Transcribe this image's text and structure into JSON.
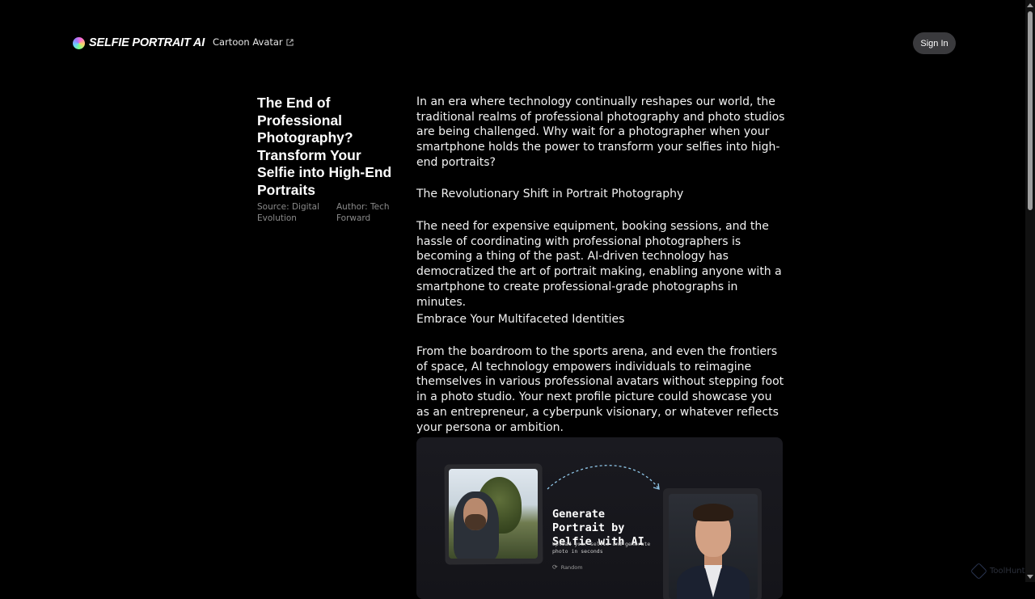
{
  "header": {
    "logo_text": "SELFIE PORTRAIT AI",
    "nav_link": "Cartoon Avatar",
    "sign_in": "Sign In"
  },
  "article": {
    "title": "The End of Professional Photography? Transform Your Selfie into High-End Portraits",
    "source": "Source: Digital Evolution",
    "author": "Author: Tech Forward",
    "paragraphs": [
      "In an era where technology continually reshapes our world, the traditional realms of professional photography and photo studios are being challenged. Why wait for a photographer when your smartphone holds the power to transform your selfies into high-end portraits?",
      "The Revolutionary Shift in Portrait Photography",
      "The need for expensive equipment, booking sessions, and the hassle of coordinating with professional photographers is becoming a thing of the past. AI-driven technology has democratized the art of portrait making, enabling anyone with a smartphone to create professional-grade photographs in minutes.",
      "Embrace Your Multifaceted Identities",
      "From the boardroom to the sports arena, and even the frontiers of space, AI technology empowers individuals to reimagine themselves in various professional avatars without stepping foot in a photo studio. Your next profile picture could showcase you as an entrepreneur, a cyberpunk visionary, or whatever reflects your persona or ambition."
    ]
  },
  "promo_card": {
    "title": "Generate Portrait by Selfie with AI",
    "subtitle": "Upload your selfie and generate photo in seconds",
    "random_label": "Random",
    "random_icon": "refresh-icon"
  },
  "watermark": "ToolHunt",
  "colors": {
    "background": "#000000",
    "signin_bg": "#3a3a3d",
    "meta_text": "#8a8a8a"
  }
}
